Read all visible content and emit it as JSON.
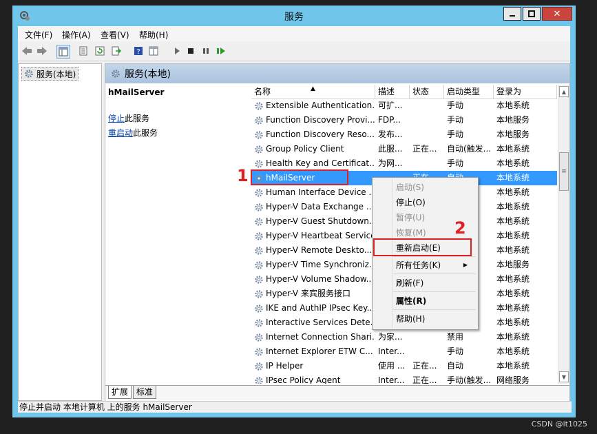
{
  "window": {
    "title": "服务",
    "close_glyph": "✕"
  },
  "menu": [
    "文件(F)",
    "操作(A)",
    "查看(V)",
    "帮助(H)"
  ],
  "tree": {
    "root_label": "服务(本地)"
  },
  "pane": {
    "header": "服务(本地)"
  },
  "detail": {
    "service_name": "hMailServer",
    "stop_link": "停止",
    "stop_suffix": "此服务",
    "restart_link": "重启动",
    "restart_suffix": "此服务"
  },
  "table": {
    "columns": [
      "名称",
      "描述",
      "状态",
      "启动类型",
      "登录为"
    ],
    "rows": [
      {
        "name": "Extensible Authentication...",
        "desc": "可扩...",
        "status": "",
        "startup": "手动",
        "logon": "本地系统"
      },
      {
        "name": "Function Discovery Provi...",
        "desc": "FDP...",
        "status": "",
        "startup": "手动",
        "logon": "本地服务"
      },
      {
        "name": "Function Discovery Reso...",
        "desc": "发布...",
        "status": "",
        "startup": "手动",
        "logon": "本地服务"
      },
      {
        "name": "Group Policy Client",
        "desc": "此服...",
        "status": "正在...",
        "startup": "自动(触发...",
        "logon": "本地系统"
      },
      {
        "name": "Health Key and Certificat...",
        "desc": "为网...",
        "status": "",
        "startup": "手动",
        "logon": "本地系统"
      },
      {
        "name": "hMailServer",
        "desc": "",
        "status": "正在...",
        "startup": "自动",
        "logon": "本地系统",
        "selected": true
      },
      {
        "name": "Human Interface Device ...",
        "desc": "",
        "status": "",
        "startup": "",
        "logon": "本地系统"
      },
      {
        "name": "Hyper-V Data Exchange ...",
        "desc": "",
        "status": "",
        "startup": "",
        "logon": "本地系统"
      },
      {
        "name": "Hyper-V Guest Shutdown...",
        "desc": "",
        "status": "",
        "startup": "",
        "logon": "本地系统"
      },
      {
        "name": "Hyper-V Heartbeat Service",
        "desc": "",
        "status": "",
        "startup": "",
        "logon": "本地系统"
      },
      {
        "name": "Hyper-V Remote Deskto...",
        "desc": "",
        "status": "",
        "startup": "",
        "logon": "本地系统"
      },
      {
        "name": "Hyper-V Time Synchroniz...",
        "desc": "",
        "status": "",
        "startup": "",
        "logon": "本地服务"
      },
      {
        "name": "Hyper-V Volume Shadow...",
        "desc": "",
        "status": "",
        "startup": "",
        "logon": "本地系统"
      },
      {
        "name": "Hyper-V 来宾服务接口",
        "desc": "",
        "status": "",
        "startup": "",
        "logon": "本地系统"
      },
      {
        "name": "IKE and AuthIP IPsec Key...",
        "desc": "",
        "status": "",
        "startup": "",
        "logon": "本地系统"
      },
      {
        "name": "Interactive Services Dete...",
        "desc": "",
        "status": "",
        "startup": "",
        "logon": "本地系统"
      },
      {
        "name": "Internet Connection Shari...",
        "desc": "为家...",
        "status": "",
        "startup": "禁用",
        "logon": "本地系统"
      },
      {
        "name": "Internet Explorer ETW C...",
        "desc": "Inter...",
        "status": "",
        "startup": "手动",
        "logon": "本地系统"
      },
      {
        "name": "IP Helper",
        "desc": "使用 ...",
        "status": "正在...",
        "startup": "自动",
        "logon": "本地系统"
      },
      {
        "name": "IPsec Policy Agent",
        "desc": "Inter...",
        "status": "正在...",
        "startup": "手动(触发...",
        "logon": "网络服务"
      }
    ]
  },
  "tabs": [
    "扩展",
    "标准"
  ],
  "statusbar": "停止并启动 本地计算机 上的服务 hMailServer",
  "context_menu": {
    "items": [
      {
        "label": "启动(S)",
        "disabled": true
      },
      {
        "label": "停止(O)",
        "disabled": false
      },
      {
        "label": "暂停(U)",
        "disabled": true
      },
      {
        "label": "恢复(M)",
        "disabled": true
      },
      {
        "label": "重新启动(E)",
        "disabled": false
      },
      {
        "label": "所有任务(K)",
        "disabled": false,
        "submenu": true
      },
      {
        "label": "刷新(F)",
        "disabled": false
      },
      {
        "label": "属性(R)",
        "disabled": false,
        "bold": true
      },
      {
        "label": "帮助(H)",
        "disabled": false
      }
    ],
    "submenu_arrow": "▶"
  },
  "annotations": {
    "marker1": "1",
    "marker2": "2"
  },
  "watermark": "CSDN @it1025",
  "colors": {
    "title_bar": "#6fc6ea",
    "selection": "#3399ff",
    "annotation_red": "#e02020"
  },
  "icons": [
    "services-icon",
    "back-icon",
    "forward-icon",
    "show-tree-icon",
    "properties-icon",
    "refresh-icon",
    "export-icon",
    "help-icon",
    "view-icon",
    "play-icon",
    "stop-icon",
    "pause-icon",
    "resume-icon",
    "gear-icon"
  ]
}
